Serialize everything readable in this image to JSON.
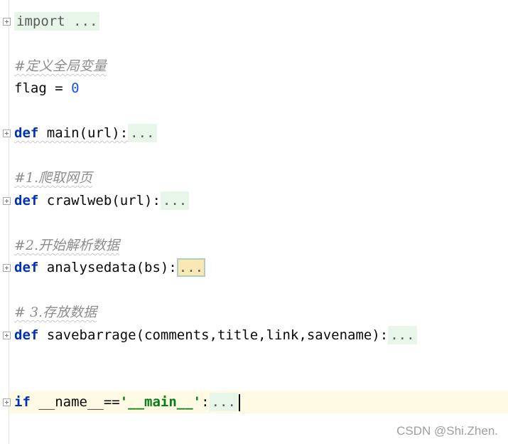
{
  "editor": {
    "lines": {
      "import": {
        "keyword": "import",
        "fold": "..."
      },
      "comment_globals": "#定义全局变量",
      "flag": {
        "name": "flag",
        "op": " = ",
        "value": "0"
      },
      "main": {
        "keyword": "def",
        "signature": " main(url):",
        "fold": "..."
      },
      "comment_crawl": "#1.爬取网页",
      "crawl": {
        "keyword": "def",
        "signature": " crawlweb(url):",
        "fold": "..."
      },
      "comment_analyse": "#2.开始解析数据",
      "analyse": {
        "keyword": "def",
        "signature": " analysedata(bs):",
        "fold": "..."
      },
      "comment_store": "# 3.存放数据",
      "save": {
        "keyword": "def",
        "signature": " savebarrage(comments,title,link,savename):",
        "fold": "..."
      },
      "ifmain": {
        "keyword": "if",
        "expr": " __name__==",
        "string": "'__main__'",
        "colon": ":",
        "fold": "..."
      }
    }
  },
  "watermark": "CSDN @Shi.Zhen.",
  "colors": {
    "keyword": "#0033b3",
    "number": "#1750eb",
    "string": "#067d17",
    "comment": "#8c8c8c",
    "fold_bg": "#e8f5e9",
    "current_line_bg": "#fffae3"
  }
}
